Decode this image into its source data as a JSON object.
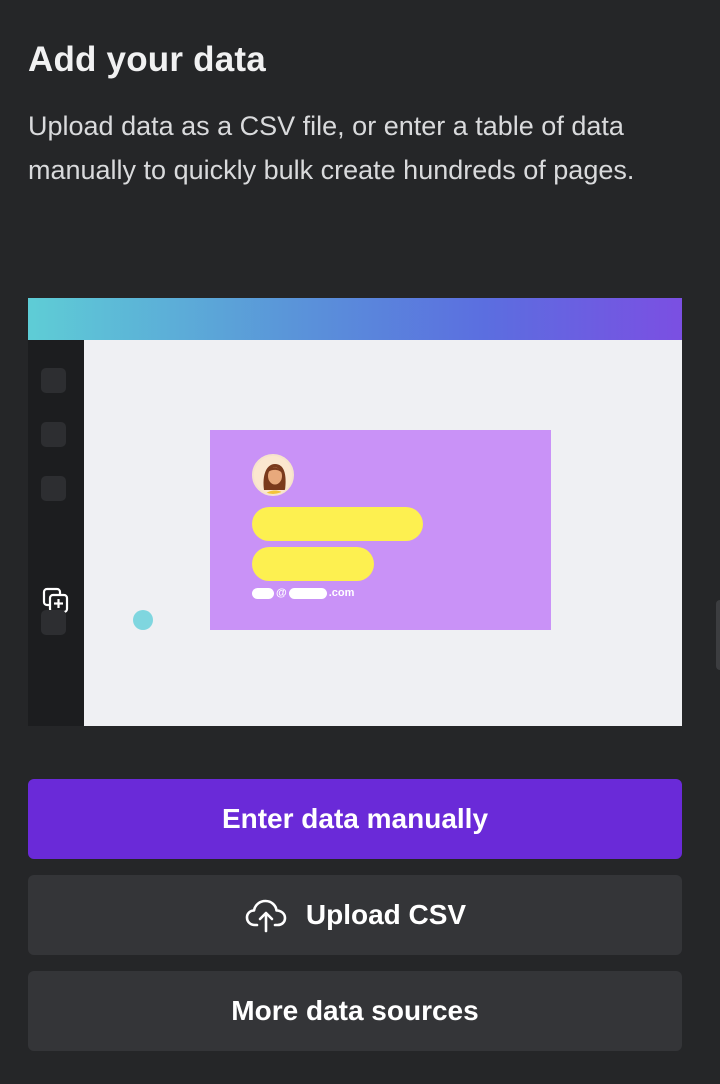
{
  "panel": {
    "title": "Add your data",
    "description": "Upload data as a CSV file, or enter a table of data manually to quickly bulk create hundreds of pages."
  },
  "illustration": {
    "email_at": "@",
    "email_domain": ".com"
  },
  "buttons": {
    "enter_manually": "Enter data manually",
    "upload_csv": "Upload CSV",
    "upload_icon": "cloud-upload-icon",
    "more_sources": "More data sources"
  },
  "colors": {
    "background": "#252628",
    "primary_button": "#6a2ad8",
    "secondary_button": "#343538",
    "card": "#c992f7",
    "highlight_yellow": "#fdf050"
  }
}
